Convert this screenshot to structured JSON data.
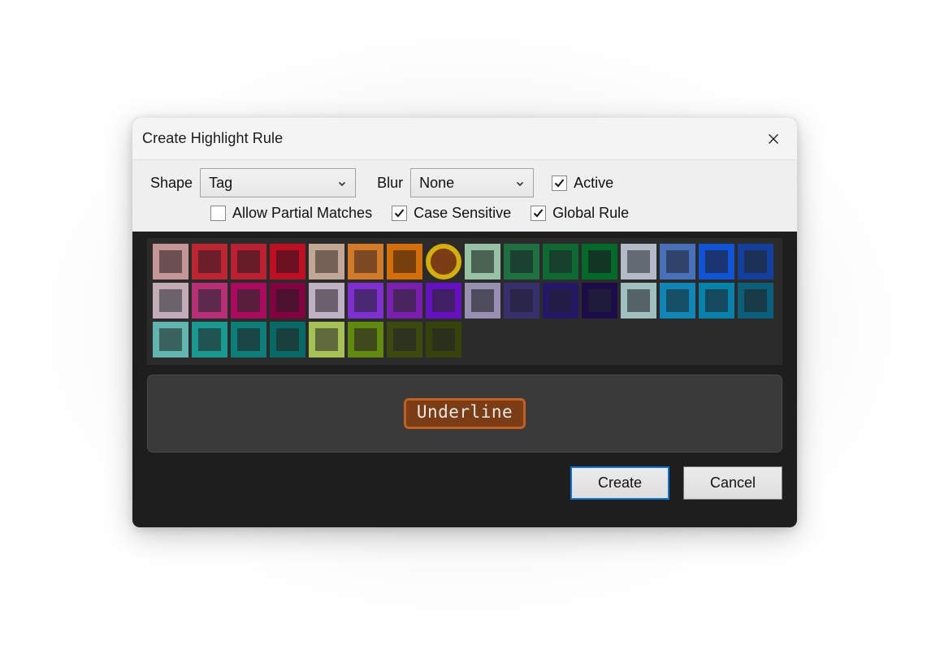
{
  "dialog": {
    "title": "Create Highlight Rule",
    "close_icon": "close-icon"
  },
  "form": {
    "shape": {
      "label": "Shape",
      "value": "Tag"
    },
    "blur": {
      "label": "Blur",
      "value": "None"
    },
    "checkboxes": [
      {
        "label": "Active",
        "checked": true
      },
      {
        "label": "Allow Partial Matches",
        "checked": false
      },
      {
        "label": "Case Sensitive",
        "checked": true
      },
      {
        "label": "Global Rule",
        "checked": true
      }
    ]
  },
  "palette": {
    "selected_index": 7,
    "rows": [
      [
        {
          "border": "#c49696",
          "fill": "#6b4f52"
        },
        {
          "border": "#bd2631",
          "fill": "#6b2029"
        },
        {
          "border": "#bd2030",
          "fill": "#661d28"
        },
        {
          "border": "#bf0f22",
          "fill": "#6b1220"
        },
        {
          "border": "#c3a795",
          "fill": "#756257"
        },
        {
          "border": "#d17a28",
          "fill": "#7b4a25"
        },
        {
          "border": "#d4700c",
          "fill": "#79400f"
        },
        {
          "border": "#d4af0a",
          "fill": "#7a3d16"
        },
        {
          "border": "#97c3a4",
          "fill": "#4c6354"
        },
        {
          "border": "#1f7040",
          "fill": "#1b4231"
        },
        {
          "border": "#0d6a33",
          "fill": "#17402c"
        },
        {
          "border": "#046a2a",
          "fill": "#123524"
        },
        {
          "border": "#b3bbc6",
          "fill": "#636a74"
        },
        {
          "border": "#4771b8",
          "fill": "#31436b"
        },
        {
          "border": "#0f53d6",
          "fill": "#1a3572"
        },
        {
          "border": "#13409e",
          "fill": "#1d3156"
        }
      ],
      [
        {
          "border": "#c3acb6",
          "fill": "#6b636c"
        },
        {
          "border": "#b82f77",
          "fill": "#5b2a4c"
        },
        {
          "border": "#ab0a5e",
          "fill": "#591d3e"
        },
        {
          "border": "#810340",
          "fill": "#4d1130"
        },
        {
          "border": "#bfb2c4",
          "fill": "#6b616e"
        },
        {
          "border": "#7f2fcf",
          "fill": "#4b2873"
        },
        {
          "border": "#7a1fb0",
          "fill": "#49255f"
        },
        {
          "border": "#6510c1",
          "fill": "#3f2063"
        },
        {
          "border": "#9790b3",
          "fill": "#4e4b5c"
        },
        {
          "border": "#372f6b",
          "fill": "#2a2547"
        },
        {
          "border": "#251767",
          "fill": "#231c45"
        },
        {
          "border": "#1c0d4a",
          "fill": "#1f1b3a"
        },
        {
          "border": "#a0bfbf",
          "fill": "#556366"
        },
        {
          "border": "#0f86b5",
          "fill": "#164f66"
        },
        {
          "border": "#0782ad",
          "fill": "#16495e"
        },
        {
          "border": "#0a5f7a",
          "fill": "#183a47"
        }
      ],
      [
        {
          "border": "#60b6ae",
          "fill": "#3c6260"
        },
        {
          "border": "#199a90",
          "fill": "#1f5350"
        },
        {
          "border": "#0c7f79",
          "fill": "#1a4745"
        },
        {
          "border": "#066b66",
          "fill": "#193f3e"
        },
        {
          "border": "#a6c254",
          "fill": "#5f6b3c"
        },
        {
          "border": "#5f8a0d",
          "fill": "#3f4a1c"
        },
        {
          "border": "#3d4a0e",
          "fill": "#2e3320"
        },
        {
          "border": "#35420a",
          "fill": "#2b301c"
        }
      ]
    ]
  },
  "preview": {
    "text": "Underline",
    "fill": "#7a3d16",
    "border": "#c2601f"
  },
  "buttons": {
    "create": "Create",
    "cancel": "Cancel"
  }
}
